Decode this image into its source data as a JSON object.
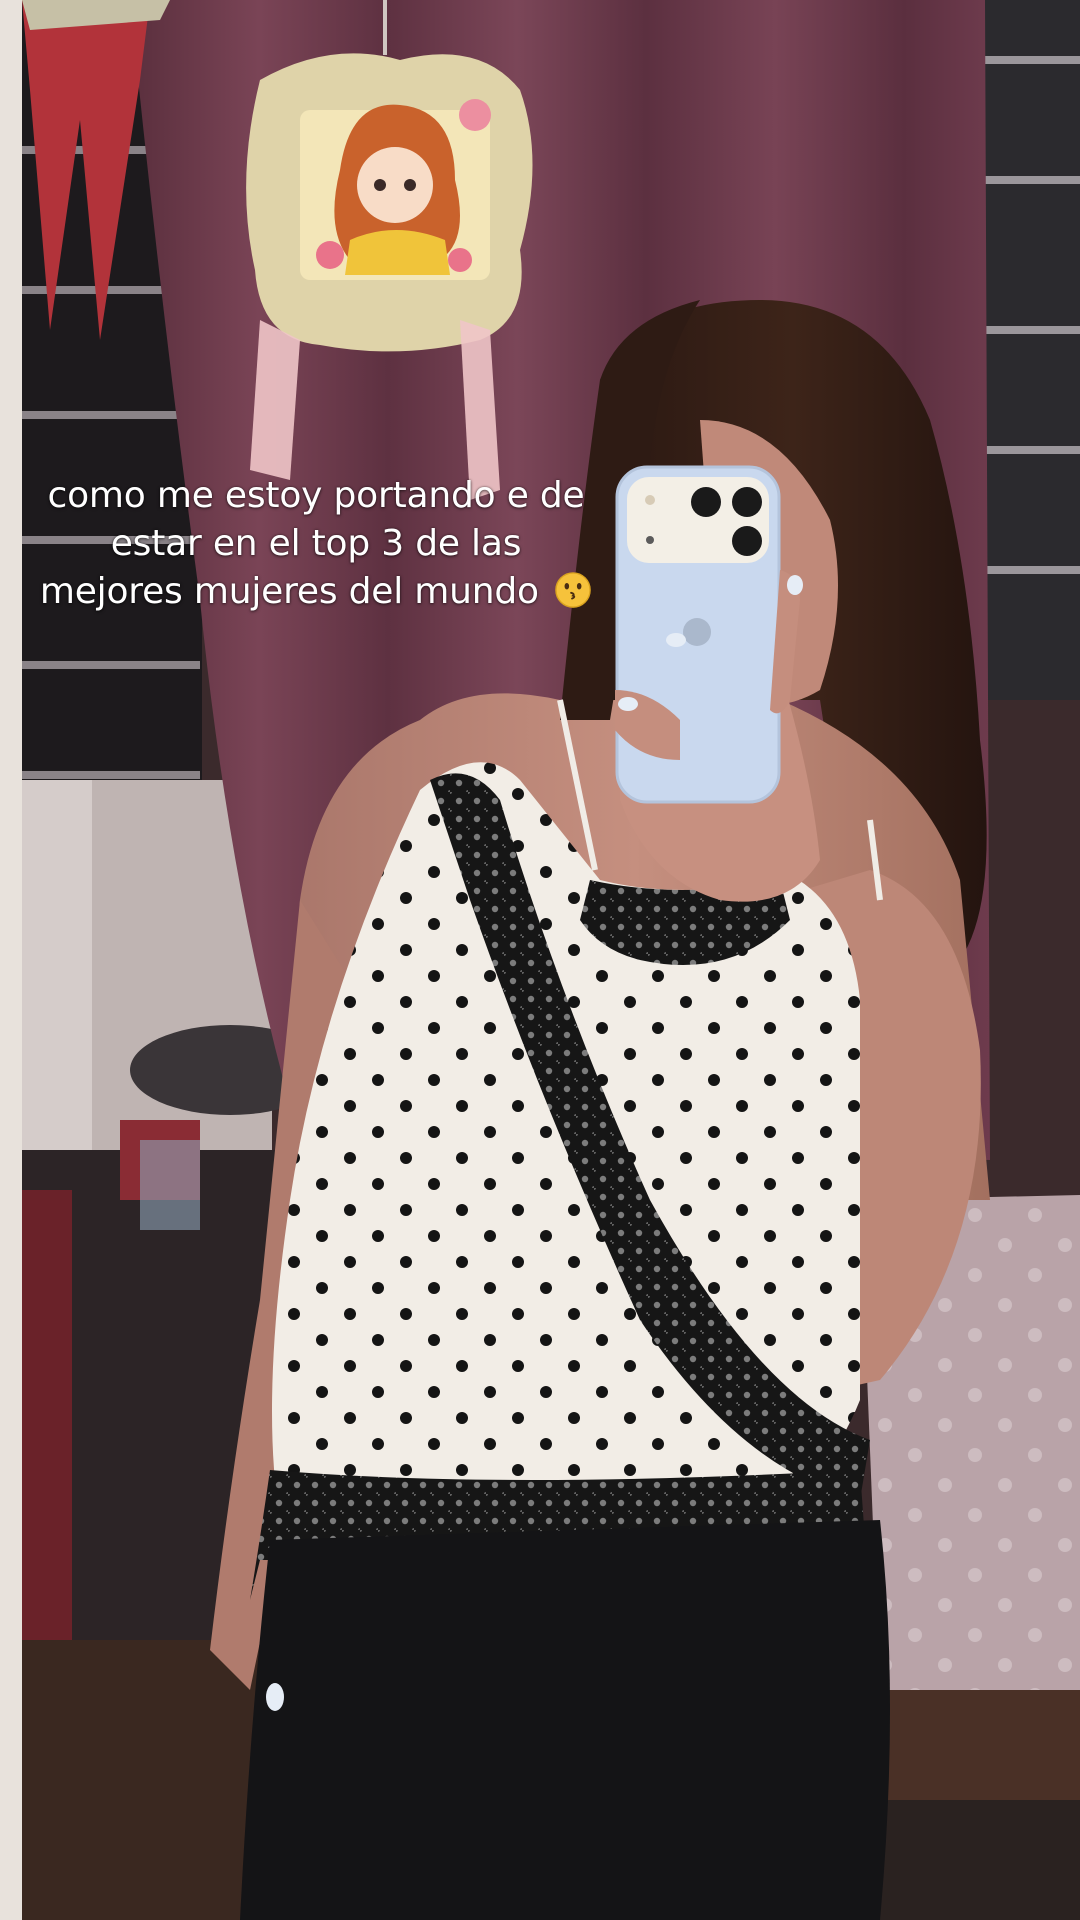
{
  "caption": {
    "line1": "como me estoy portando e de",
    "line2": "estar en el top 3 de las",
    "line3": "mejores mujeres del mundo"
  },
  "emoji": {
    "name": "kissing-face-emoji",
    "glyph": "😗"
  },
  "colors": {
    "curtain": "#6b3a4a",
    "top_fabric": "#f3efe9",
    "lace": "#151515",
    "phone_case": "#c9d8ee",
    "pants": "#141416",
    "wall": "#d9d2cf"
  }
}
